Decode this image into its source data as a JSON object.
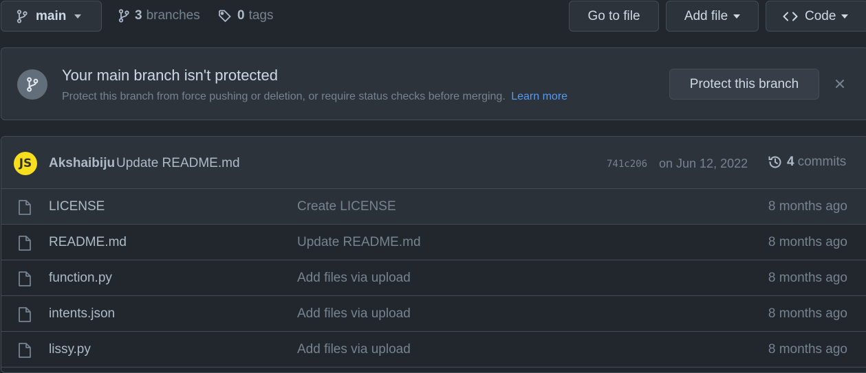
{
  "toolbar": {
    "branch": "main",
    "branches_count": "3",
    "branches_label": "branches",
    "tags_count": "0",
    "tags_label": "tags",
    "go_to_file": "Go to file",
    "add_file": "Add file",
    "code": "Code"
  },
  "banner": {
    "title": "Your main branch isn't protected",
    "description": "Protect this branch from force pushing or deletion, or require status checks before merging.",
    "learn_more": "Learn more",
    "protect_button": "Protect this branch"
  },
  "latest_commit": {
    "avatar_text": "JS",
    "author": "Akshaibiju",
    "message": "Update README.md",
    "sha": "741c206",
    "date": "on Jun 12, 2022",
    "commits_count": "4",
    "commits_label": "commits"
  },
  "files": [
    {
      "name": "LICENSE",
      "message": "Create LICENSE",
      "age": "8 months ago"
    },
    {
      "name": "README.md",
      "message": "Update README.md",
      "age": "8 months ago"
    },
    {
      "name": "function.py",
      "message": "Add files via upload",
      "age": "8 months ago"
    },
    {
      "name": "intents.json",
      "message": "Add files via upload",
      "age": "8 months ago"
    },
    {
      "name": "lissy.py",
      "message": "Add files via upload",
      "age": "8 months ago"
    }
  ],
  "icons": {
    "branch": "git-branch-icon",
    "tag": "tag-icon",
    "caret": "triangle-down-icon",
    "code": "code-icon",
    "close": "x-icon",
    "history": "history-icon",
    "file": "file-icon"
  },
  "colors": {
    "background": "#22272e",
    "surface": "#2d333b",
    "border": "#444c56",
    "link": "#539bf5",
    "muted_text": "#768390",
    "avatar_bg": "#f7df1e"
  }
}
